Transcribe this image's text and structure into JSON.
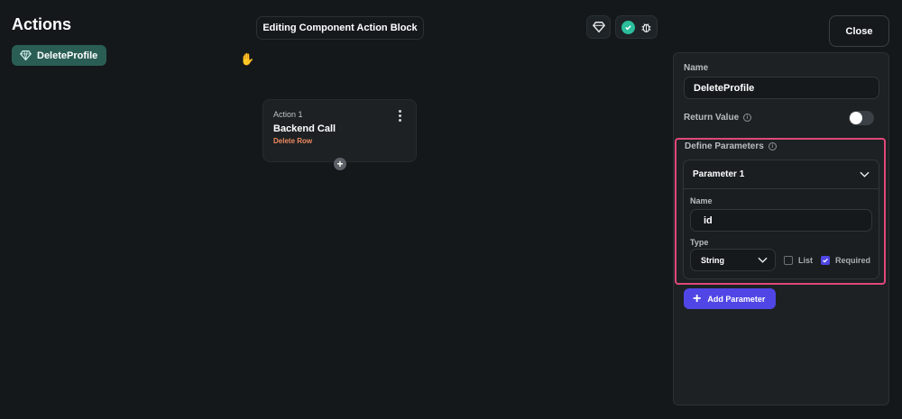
{
  "header": {
    "title": "Actions",
    "editing_label": "Editing Component Action Block",
    "close_label": "Close"
  },
  "actions_list": {
    "items": [
      {
        "label": "DeleteProfile",
        "icon": "gem-icon"
      }
    ]
  },
  "canvas": {
    "card": {
      "step_label": "Action 1",
      "title": "Backend Call",
      "subtitle": "Delete Row"
    }
  },
  "panel": {
    "name_label": "Name",
    "name_value": "DeleteProfile",
    "return_value_label": "Return Value",
    "return_value_enabled": false,
    "define_parameters_label": "Define Parameters",
    "parameter": {
      "header": "Parameter 1",
      "name_label": "Name",
      "name_value": "id",
      "type_label": "Type",
      "type_value": "String",
      "list_label": "List",
      "list_checked": false,
      "required_label": "Required",
      "required_checked": true
    },
    "add_parameter_label": "Add Parameter"
  },
  "colors": {
    "background": "#14181b",
    "chip": "#2a5e55",
    "accent": "#5046e5",
    "highlight": "#e04878",
    "action_subtitle": "#ee8b5f",
    "success": "#2bbd9c"
  }
}
